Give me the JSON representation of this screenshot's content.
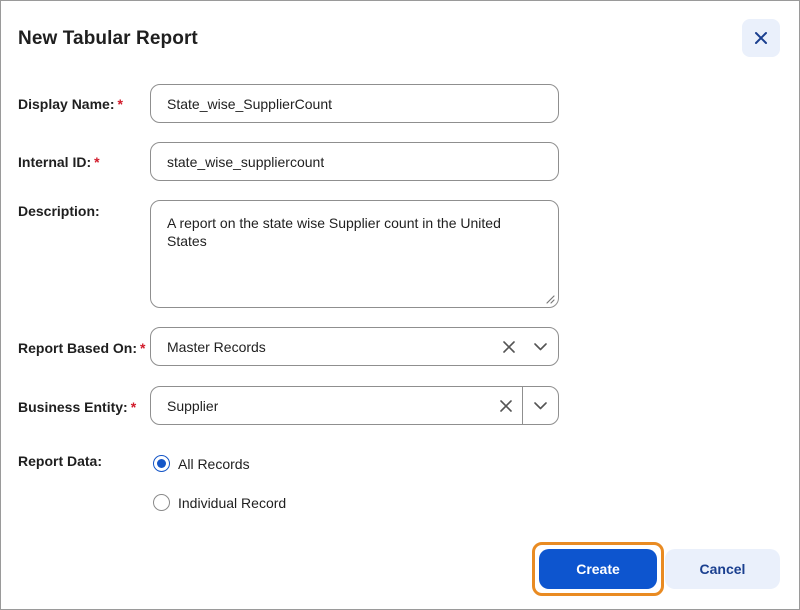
{
  "dialog": {
    "title": "New Tabular Report",
    "close_icon": "close-icon"
  },
  "form": {
    "display_name": {
      "label": "Display Name:",
      "required_mark": "*",
      "value": "State_wise_SupplierCount"
    },
    "internal_id": {
      "label": "Internal ID:",
      "required_mark": "*",
      "value": "state_wise_suppliercount"
    },
    "description": {
      "label": "Description:",
      "value": "A report on the state wise Supplier count in the United States"
    },
    "report_based_on": {
      "label": "Report Based On:",
      "required_mark": "*",
      "value": "Master Records"
    },
    "business_entity": {
      "label": "Business Entity:",
      "required_mark": "*",
      "value": "Supplier"
    },
    "report_data": {
      "label": "Report Data:",
      "options": [
        {
          "label": "All Records",
          "selected": true
        },
        {
          "label": "Individual Record",
          "selected": false
        }
      ]
    }
  },
  "actions": {
    "create_label": "Create",
    "cancel_label": "Cancel"
  },
  "colors": {
    "primary": "#0d55cf",
    "highlight": "#e98b22",
    "required": "#d11a2a",
    "secondary_bg": "#eaf0fb"
  }
}
